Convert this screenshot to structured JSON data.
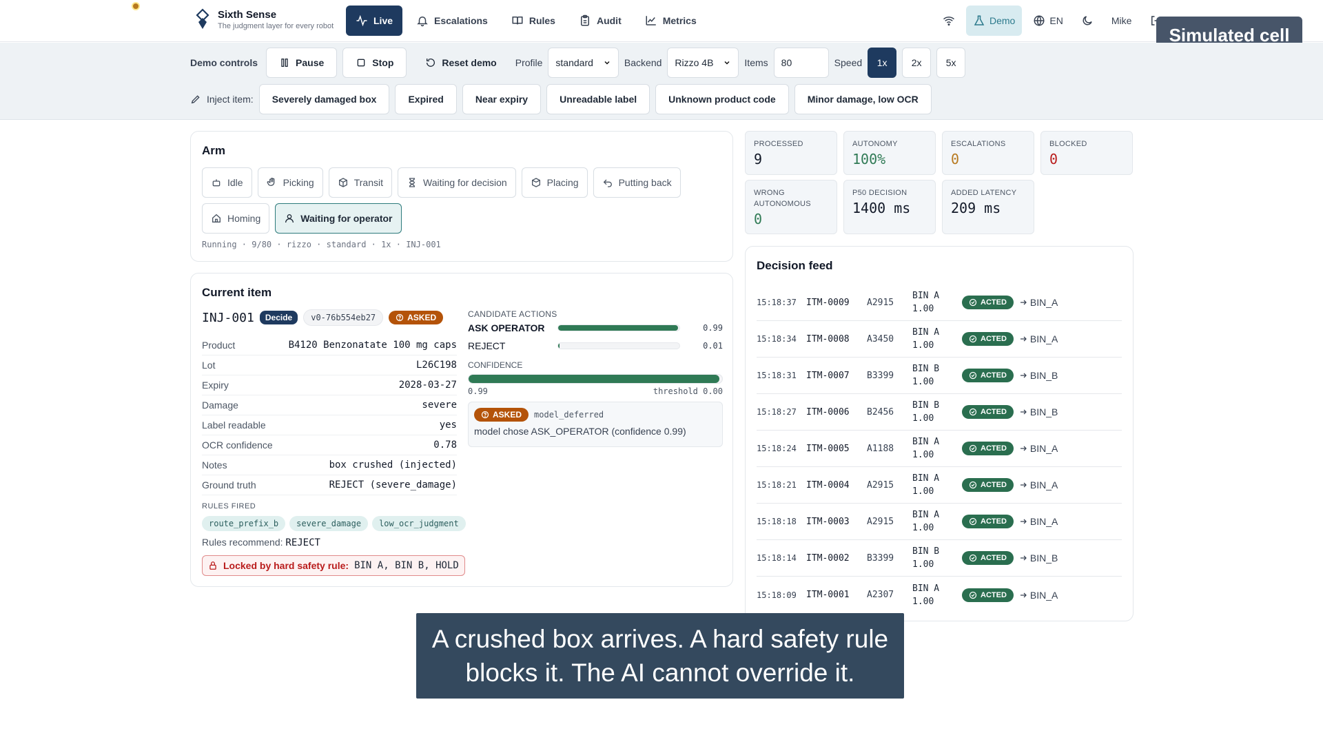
{
  "brand": {
    "title": "Sixth Sense",
    "subtitle": "The judgment layer for every robot"
  },
  "nav": {
    "tabs": [
      {
        "label": "Live",
        "icon": "activity-icon",
        "active": true
      },
      {
        "label": "Escalations",
        "icon": "bell-icon"
      },
      {
        "label": "Rules",
        "icon": "book-icon"
      },
      {
        "label": "Audit",
        "icon": "clipboard-icon"
      },
      {
        "label": "Metrics",
        "icon": "chart-icon"
      }
    ],
    "demo_label": "Demo",
    "lang_label": "EN",
    "user_name": "Mike"
  },
  "badge": {
    "simulated": "Simulated cell"
  },
  "demo_controls": {
    "label": "Demo controls",
    "pause_label": "Pause",
    "stop_label": "Stop",
    "reset_label": "Reset demo",
    "profile_label": "Profile",
    "profile_value": "standard",
    "backend_label": "Backend",
    "backend_value": "Rizzo 4B",
    "items_label": "Items",
    "items_value": "80",
    "speed_label": "Speed",
    "speeds": [
      "1x",
      "2x",
      "5x"
    ],
    "speed_selected": "1x",
    "inject_label": "Inject item:",
    "inject_items": [
      "Severely damaged box",
      "Expired",
      "Near expiry",
      "Unreadable label",
      "Unknown product code",
      "Minor damage, low OCR"
    ]
  },
  "arm": {
    "title": "Arm",
    "states": [
      "Idle",
      "Picking",
      "Transit",
      "Waiting for decision",
      "Placing",
      "Putting back",
      "Homing",
      "Waiting for operator"
    ],
    "active_state": "Waiting for operator",
    "status_line": "Running · 9/80 · rizzo · standard · 1x · INJ-001"
  },
  "current_item": {
    "title": "Current item",
    "id": "INJ-001",
    "decide_tag": "Decide",
    "version_tag": "v0-76b554eb27",
    "asked_tag": "ASKED",
    "props": [
      {
        "k": "Product",
        "v": "B4120 Benzonatate 100 mg caps"
      },
      {
        "k": "Lot",
        "v": "L26C198"
      },
      {
        "k": "Expiry",
        "v": "2028-03-27"
      },
      {
        "k": "Damage",
        "v": "severe"
      },
      {
        "k": "Label readable",
        "v": "yes"
      },
      {
        "k": "OCR confidence",
        "v": "0.78"
      },
      {
        "k": "Notes",
        "v": "box crushed (injected)"
      },
      {
        "k": "Ground truth",
        "v": "REJECT (severe_damage)"
      }
    ],
    "rules_fired_label": "RULES FIRED",
    "rules_fired": [
      "route_prefix_b",
      "severe_damage",
      "low_ocr_judgment"
    ],
    "rules_recommend_label": "Rules recommend:",
    "rules_recommend_value": "REJECT",
    "locked_label": "Locked by hard safety rule:",
    "locked_value": "BIN A, BIN B, HOLD",
    "candidate_label": "CANDIDATE ACTIONS",
    "candidates": [
      {
        "name": "ASK OPERATOR",
        "p": 0.99,
        "p_text": "0.99"
      },
      {
        "name": "REJECT",
        "p": 0.01,
        "p_text": "0.01"
      }
    ],
    "confidence_label": "CONFIDENCE",
    "confidence": 0.99,
    "confidence_text": "0.99",
    "threshold_text": "threshold 0.00",
    "asked_reason": "model_deferred",
    "asked_message": "model chose ASK_OPERATOR (confidence 0.99)"
  },
  "stats": [
    {
      "label": "PROCESSED",
      "value": "9",
      "color": "#111827"
    },
    {
      "label": "AUTONOMY",
      "value": "100%",
      "color": "#2f7a55"
    },
    {
      "label": "ESCALATIONS",
      "value": "0",
      "color": "#b7791f"
    },
    {
      "label": "BLOCKED",
      "value": "0",
      "color": "#b91c1c"
    },
    {
      "label": "WRONG AUTONOMOUS",
      "value": "0",
      "color": "#2f7a55"
    },
    {
      "label": "P50 DECISION",
      "value": "1400 ms",
      "color": "#111827"
    },
    {
      "label": "ADDED LATENCY",
      "value": "209 ms",
      "color": "#111827"
    }
  ],
  "feed": {
    "title": "Decision feed",
    "acted_label": "ACTED",
    "rows": [
      {
        "time": "15:18:37",
        "id": "ITM-0009",
        "sku": "A2915",
        "bin": "BIN A",
        "score": "1.00",
        "dest": "BIN_A"
      },
      {
        "time": "15:18:34",
        "id": "ITM-0008",
        "sku": "A3450",
        "bin": "BIN A",
        "score": "1.00",
        "dest": "BIN_A"
      },
      {
        "time": "15:18:31",
        "id": "ITM-0007",
        "sku": "B3399",
        "bin": "BIN B",
        "score": "1.00",
        "dest": "BIN_B"
      },
      {
        "time": "15:18:27",
        "id": "ITM-0006",
        "sku": "B2456",
        "bin": "BIN B",
        "score": "1.00",
        "dest": "BIN_B"
      },
      {
        "time": "15:18:24",
        "id": "ITM-0005",
        "sku": "A1188",
        "bin": "BIN A",
        "score": "1.00",
        "dest": "BIN_A"
      },
      {
        "time": "15:18:21",
        "id": "ITM-0004",
        "sku": "A2915",
        "bin": "BIN A",
        "score": "1.00",
        "dest": "BIN_A"
      },
      {
        "time": "15:18:18",
        "id": "ITM-0003",
        "sku": "A2915",
        "bin": "BIN A",
        "score": "1.00",
        "dest": "BIN_A"
      },
      {
        "time": "15:18:14",
        "id": "ITM-0002",
        "sku": "B3399",
        "bin": "BIN B",
        "score": "1.00",
        "dest": "BIN_B"
      },
      {
        "time": "15:18:09",
        "id": "ITM-0001",
        "sku": "A2307",
        "bin": "BIN A",
        "score": "1.00",
        "dest": "BIN_A"
      }
    ]
  },
  "caption": "A crushed box arrives. A hard safety rule blocks it. The AI cannot override it."
}
